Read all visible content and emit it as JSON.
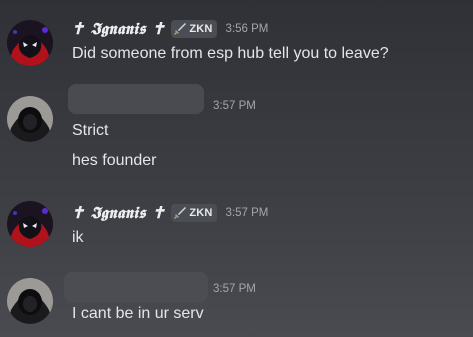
{
  "messages": [
    {
      "user": "✝ 𝕴𝖌𝖓𝖆𝖓𝖎𝖘 ✝",
      "user_plain": "Ignanis",
      "tag": "ZKN",
      "time": "3:56 PM",
      "lines": [
        "Did someone from esp hub tell you to leave?"
      ]
    },
    {
      "time": "3:57 PM",
      "lines": [
        "Strict",
        "hes founder"
      ]
    },
    {
      "user": "✝ 𝕴𝖌𝖓𝖆𝖓𝖎𝖘 ✝",
      "tag": "ZKN",
      "time": "3:57 PM",
      "lines": [
        "ik"
      ]
    },
    {
      "time": "3:57 PM",
      "lines": [
        "I cant be in ur serv"
      ]
    }
  ],
  "colors": {
    "background_top": "#2f3136",
    "background_bottom": "#4a4b51",
    "text": "#e3e5e8",
    "timestamp": "#a3a6aa",
    "tag_bg": "#4b4d55"
  },
  "icons": {
    "tag": "sword-icon",
    "avatar_1": "spider-man-avatar",
    "avatar_2": "hooded-figure-avatar"
  }
}
